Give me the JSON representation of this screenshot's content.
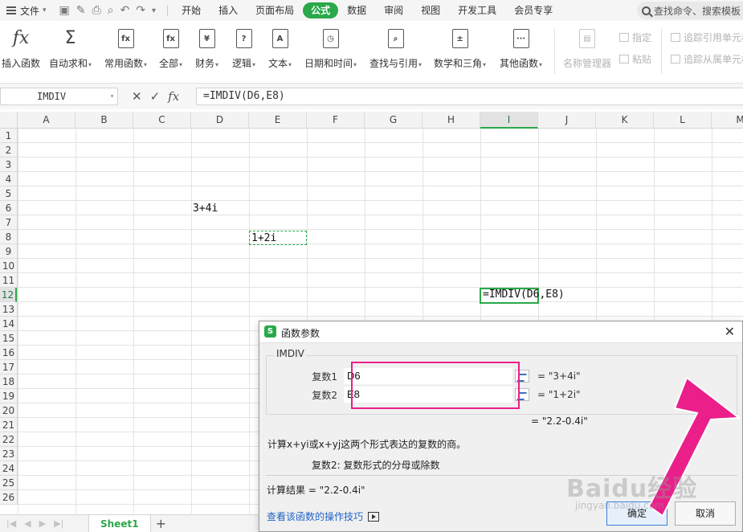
{
  "menubar": {
    "file_label": "文件",
    "tabs": [
      "开始",
      "插入",
      "页面布局",
      "公式",
      "数据",
      "审阅",
      "视图",
      "开发工具",
      "会员专享"
    ],
    "active_tab": "公式",
    "search_text": "查找命令、搜索模板"
  },
  "ribbon": {
    "insert_function": "插入函数",
    "autosum": "自动求和",
    "common_functions": "常用函数",
    "all": "全部",
    "financial": "财务",
    "logical": "逻辑",
    "text": "文本",
    "datetime": "日期和时间",
    "lookup": "查找与引用",
    "math": "数学和三角",
    "other": "其他函数",
    "name_manager": "名称管理器",
    "specify": "指定",
    "paste": "粘贴",
    "trace_precedents": "追踪引用单元格",
    "trace_dependents": "追踪从属单元格"
  },
  "formula_bar": {
    "name_box": "IMDIV",
    "formula": "=IMDIV(D6,E8)"
  },
  "grid": {
    "columns": [
      "A",
      "B",
      "C",
      "D",
      "E",
      "F",
      "G",
      "H",
      "I",
      "J",
      "K",
      "L",
      "M"
    ],
    "selected_column": "I",
    "rows": [
      "1",
      "2",
      "3",
      "4",
      "5",
      "6",
      "7",
      "8",
      "9",
      "10",
      "11",
      "12",
      "13",
      "14",
      "15",
      "16",
      "17",
      "18",
      "19",
      "20",
      "21",
      "22",
      "23",
      "24",
      "25",
      "26"
    ],
    "selected_row": "12",
    "d6": "3+4i",
    "e8": "1+2i",
    "i12": "=IMDIV(D6,E8)"
  },
  "sheets": {
    "active": "Sheet1"
  },
  "dialog": {
    "title": "函数参数",
    "function_name": "IMDIV",
    "arg1_label": "复数1",
    "arg1_value": "D6",
    "arg1_result": "= \"3+4i\"",
    "arg2_label": "复数2",
    "arg2_value": "E8",
    "arg2_result": "= \"1+2i\"",
    "overall_result": "= \"2.2-0.4i\"",
    "description": "计算x+yi或x+yj这两个形式表达的复数的商。",
    "arg_help": "复数2:  复数形式的分母或除数",
    "calc_result": "计算结果 =  \"2.2-0.4i\"",
    "help_link": "查看该函数的操作技巧",
    "ok": "确定",
    "cancel": "取消"
  },
  "overlay": {
    "watermark": "Baidu经验",
    "watermark_sub": "jingyan.baidu.com",
    "accent": "#ea1f8a"
  }
}
